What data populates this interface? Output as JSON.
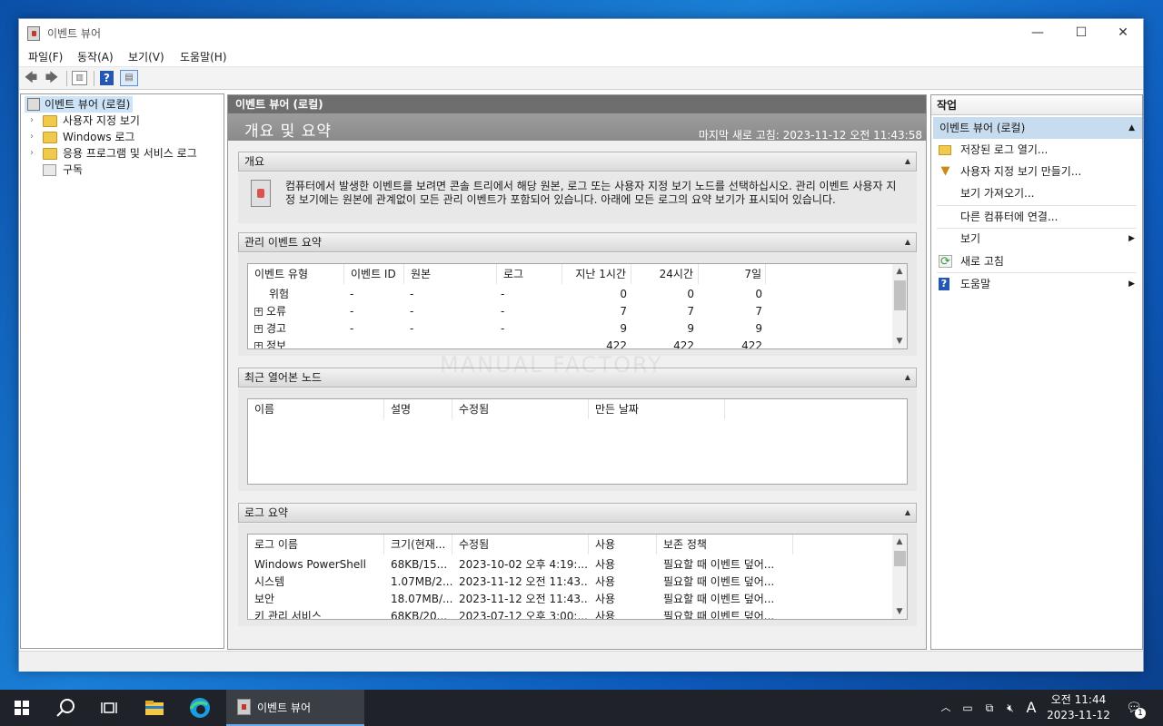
{
  "window": {
    "title": "이벤트 뷰어",
    "controls": {
      "minimize": "—",
      "maximize": "☐",
      "close": "✕"
    }
  },
  "menu": [
    "파일(F)",
    "동작(A)",
    "보기(V)",
    "도움말(H)"
  ],
  "toolbar": {
    "icons": [
      "back-arrow-icon",
      "forward-arrow-icon",
      "console-tree-icon",
      "help-icon",
      "action-pane-icon"
    ]
  },
  "tree": {
    "root": "이벤트 뷰어 (로컬)",
    "items": [
      {
        "label": "사용자 지정 보기",
        "expandable": true
      },
      {
        "label": "Windows 로그",
        "expandable": true
      },
      {
        "label": "응용 프로그램 및 서비스 로그",
        "expandable": true
      },
      {
        "label": "구독",
        "expandable": false
      }
    ]
  },
  "center": {
    "header": "이벤트 뷰어 (로컬)",
    "band_title": "개요 및 요약",
    "last_refresh": "마지막 새로 고침: 2023-11-12 오전 11:43:58",
    "overview": {
      "title": "개요",
      "text": "컴퓨터에서 발생한 이벤트를 보려면 콘솔 트리에서 해당 원본, 로그 또는 사용자 지정 보기 노드를 선택하십시오. 관리 이벤트 사용자 지정 보기에는 원본에 관계없이 모든 관리 이벤트가 포함되어 있습니다. 아래에 모든 로그의 요약 보기가 표시되어 있습니다."
    },
    "admin_summary": {
      "title": "관리 이벤트 요약",
      "columns": [
        "이벤트 유형",
        "이벤트 ID",
        "원본",
        "로그",
        "지난 1시간",
        "24시간",
        "7일"
      ],
      "rows": [
        {
          "type": "위험",
          "expand": false,
          "id": "-",
          "source": "-",
          "log": "-",
          "h1": "0",
          "h24": "0",
          "d7": "0"
        },
        {
          "type": "오류",
          "expand": true,
          "id": "-",
          "source": "-",
          "log": "-",
          "h1": "7",
          "h24": "7",
          "d7": "7"
        },
        {
          "type": "경고",
          "expand": true,
          "id": "-",
          "source": "-",
          "log": "-",
          "h1": "9",
          "h24": "9",
          "d7": "9"
        },
        {
          "type": "정보",
          "expand": true,
          "id": "",
          "source": "",
          "log": "",
          "h1": "422",
          "h24": "422",
          "d7": "422"
        }
      ]
    },
    "recent_nodes": {
      "title": "최근 열어본 노드",
      "columns": [
        "이름",
        "설명",
        "수정됨",
        "만든 날짜"
      ]
    },
    "log_summary": {
      "title": "로그 요약",
      "columns": [
        "로그 이름",
        "크기(현재...",
        "수정됨",
        "사용",
        "보존 정책"
      ],
      "rows": [
        {
          "name": "Windows PowerShell",
          "size": "68KB/15...",
          "modified": "2023-10-02 오후 4:19:...",
          "enabled": "사용",
          "retention": "필요할 때 이벤트 덮어..."
        },
        {
          "name": "시스템",
          "size": "1.07MB/2...",
          "modified": "2023-11-12 오전 11:43...",
          "enabled": "사용",
          "retention": "필요할 때 이벤트 덮어..."
        },
        {
          "name": "보안",
          "size": "18.07MB/...",
          "modified": "2023-11-12 오전 11:43...",
          "enabled": "사용",
          "retention": "필요할 때 이벤트 덮어..."
        },
        {
          "name": "키 관리 서비스",
          "size": "68KB/20...",
          "modified": "2023-07-12 오후 3:00:...",
          "enabled": "사용",
          "retention": "필요할 때 이벤트 덮어..."
        }
      ]
    },
    "watermark": "MANUAL FACTORY"
  },
  "actions": {
    "header": "작업",
    "section": "이벤트 뷰어 (로컬)",
    "items": [
      {
        "label": "저장된 로그 열기...",
        "icon": "open-folder-icon"
      },
      {
        "label": "사용자 지정 보기 만들기...",
        "icon": "filter-icon"
      },
      {
        "label": "보기 가져오기...",
        "icon": ""
      },
      {
        "label": "다른 컴퓨터에 연결...",
        "icon": ""
      },
      {
        "label": "보기",
        "icon": "",
        "submenu": true
      },
      {
        "label": "새로 고침",
        "icon": "refresh-icon"
      },
      {
        "label": "도움말",
        "icon": "help-icon",
        "submenu": true
      }
    ]
  },
  "taskbar": {
    "active_app": "이벤트 뷰어",
    "time": "오전 11:44",
    "date": "2023-11-12",
    "ime": "A",
    "notifications": "1"
  }
}
